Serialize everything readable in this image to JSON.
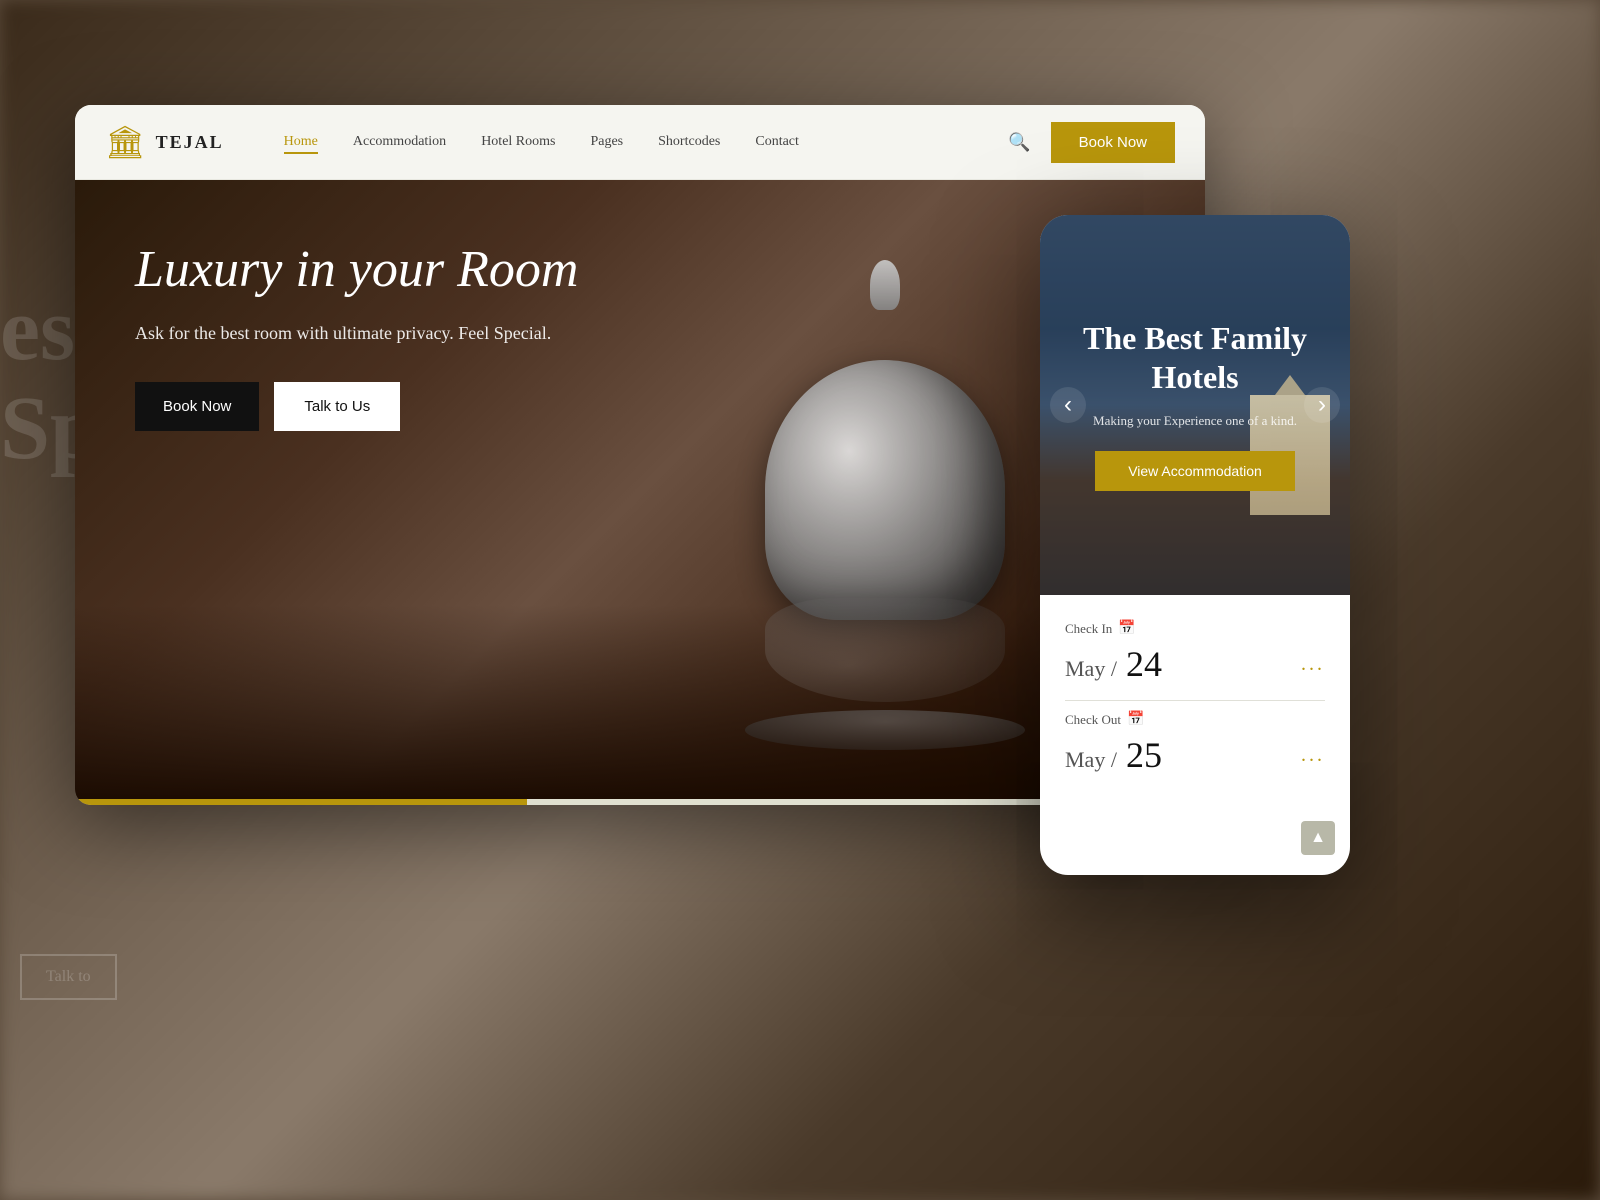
{
  "brand": {
    "name": "TEJAL",
    "logo_icon": "🏛"
  },
  "nav": {
    "links": [
      {
        "label": "Home",
        "active": true
      },
      {
        "label": "Accommodation",
        "active": false
      },
      {
        "label": "Hotel Rooms",
        "active": false
      },
      {
        "label": "Pages",
        "active": false
      },
      {
        "label": "Shortcodes",
        "active": false
      },
      {
        "label": "Contact",
        "active": false
      }
    ],
    "book_now_label": "Book Now"
  },
  "hero": {
    "title": "Luxury in your Room",
    "subtitle": "Ask for the best room with ultimate privacy. Feel Special.",
    "btn_book": "Book Now",
    "btn_talk": "Talk to Us"
  },
  "mobile": {
    "hero_title": "The Best Family Hotels",
    "hero_subtitle": "Making your Experience one of a kind.",
    "view_btn_label": "View Accommodation",
    "booking": {
      "checkin_label": "Check In",
      "checkin_month": "May /",
      "checkin_day": "24",
      "checkin_dots": "...",
      "checkout_label": "Check Out",
      "checkout_month": "May /",
      "checkout_day": "25",
      "checkout_dots": "..."
    }
  },
  "background": {
    "left_text_lines": [
      "est",
      "Sp"
    ],
    "left_btn": "Talk to"
  }
}
